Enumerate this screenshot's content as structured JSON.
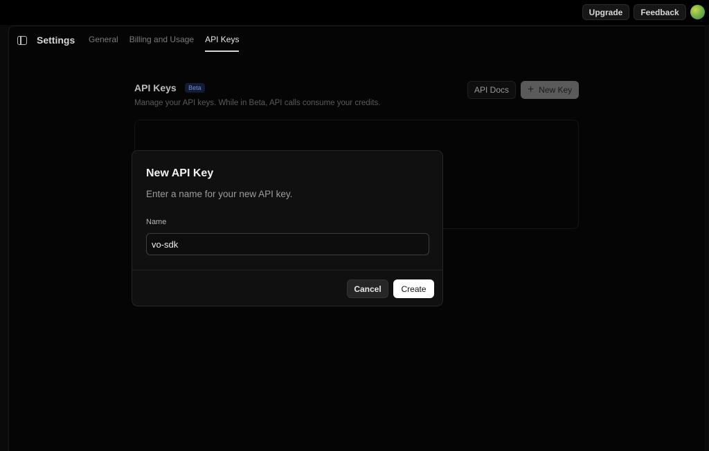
{
  "topbar": {
    "upgrade_label": "Upgrade",
    "feedback_label": "Feedback"
  },
  "settings": {
    "title": "Settings",
    "tabs": [
      {
        "label": "General",
        "active": false
      },
      {
        "label": "Billing and Usage",
        "active": false
      },
      {
        "label": "API Keys",
        "active": true
      }
    ]
  },
  "api_keys": {
    "title": "API Keys",
    "badge": "Beta",
    "description": "Manage your API keys. While in Beta, API calls consume your credits.",
    "api_docs_label": "API Docs",
    "new_key_label": "New Key"
  },
  "modal": {
    "title": "New API Key",
    "description": "Enter a name for your new API key.",
    "field_label": "Name",
    "field_value": "vo-sdk",
    "cancel_label": "Cancel",
    "create_label": "Create"
  },
  "icons": {
    "sidebar": "sidebar-toggle-icon",
    "plus": "plus-icon",
    "avatar": "user-avatar"
  },
  "colors": {
    "background": "#0a0a0a",
    "primary_button": "#ffffff",
    "badge_text": "#6f8cd8"
  }
}
